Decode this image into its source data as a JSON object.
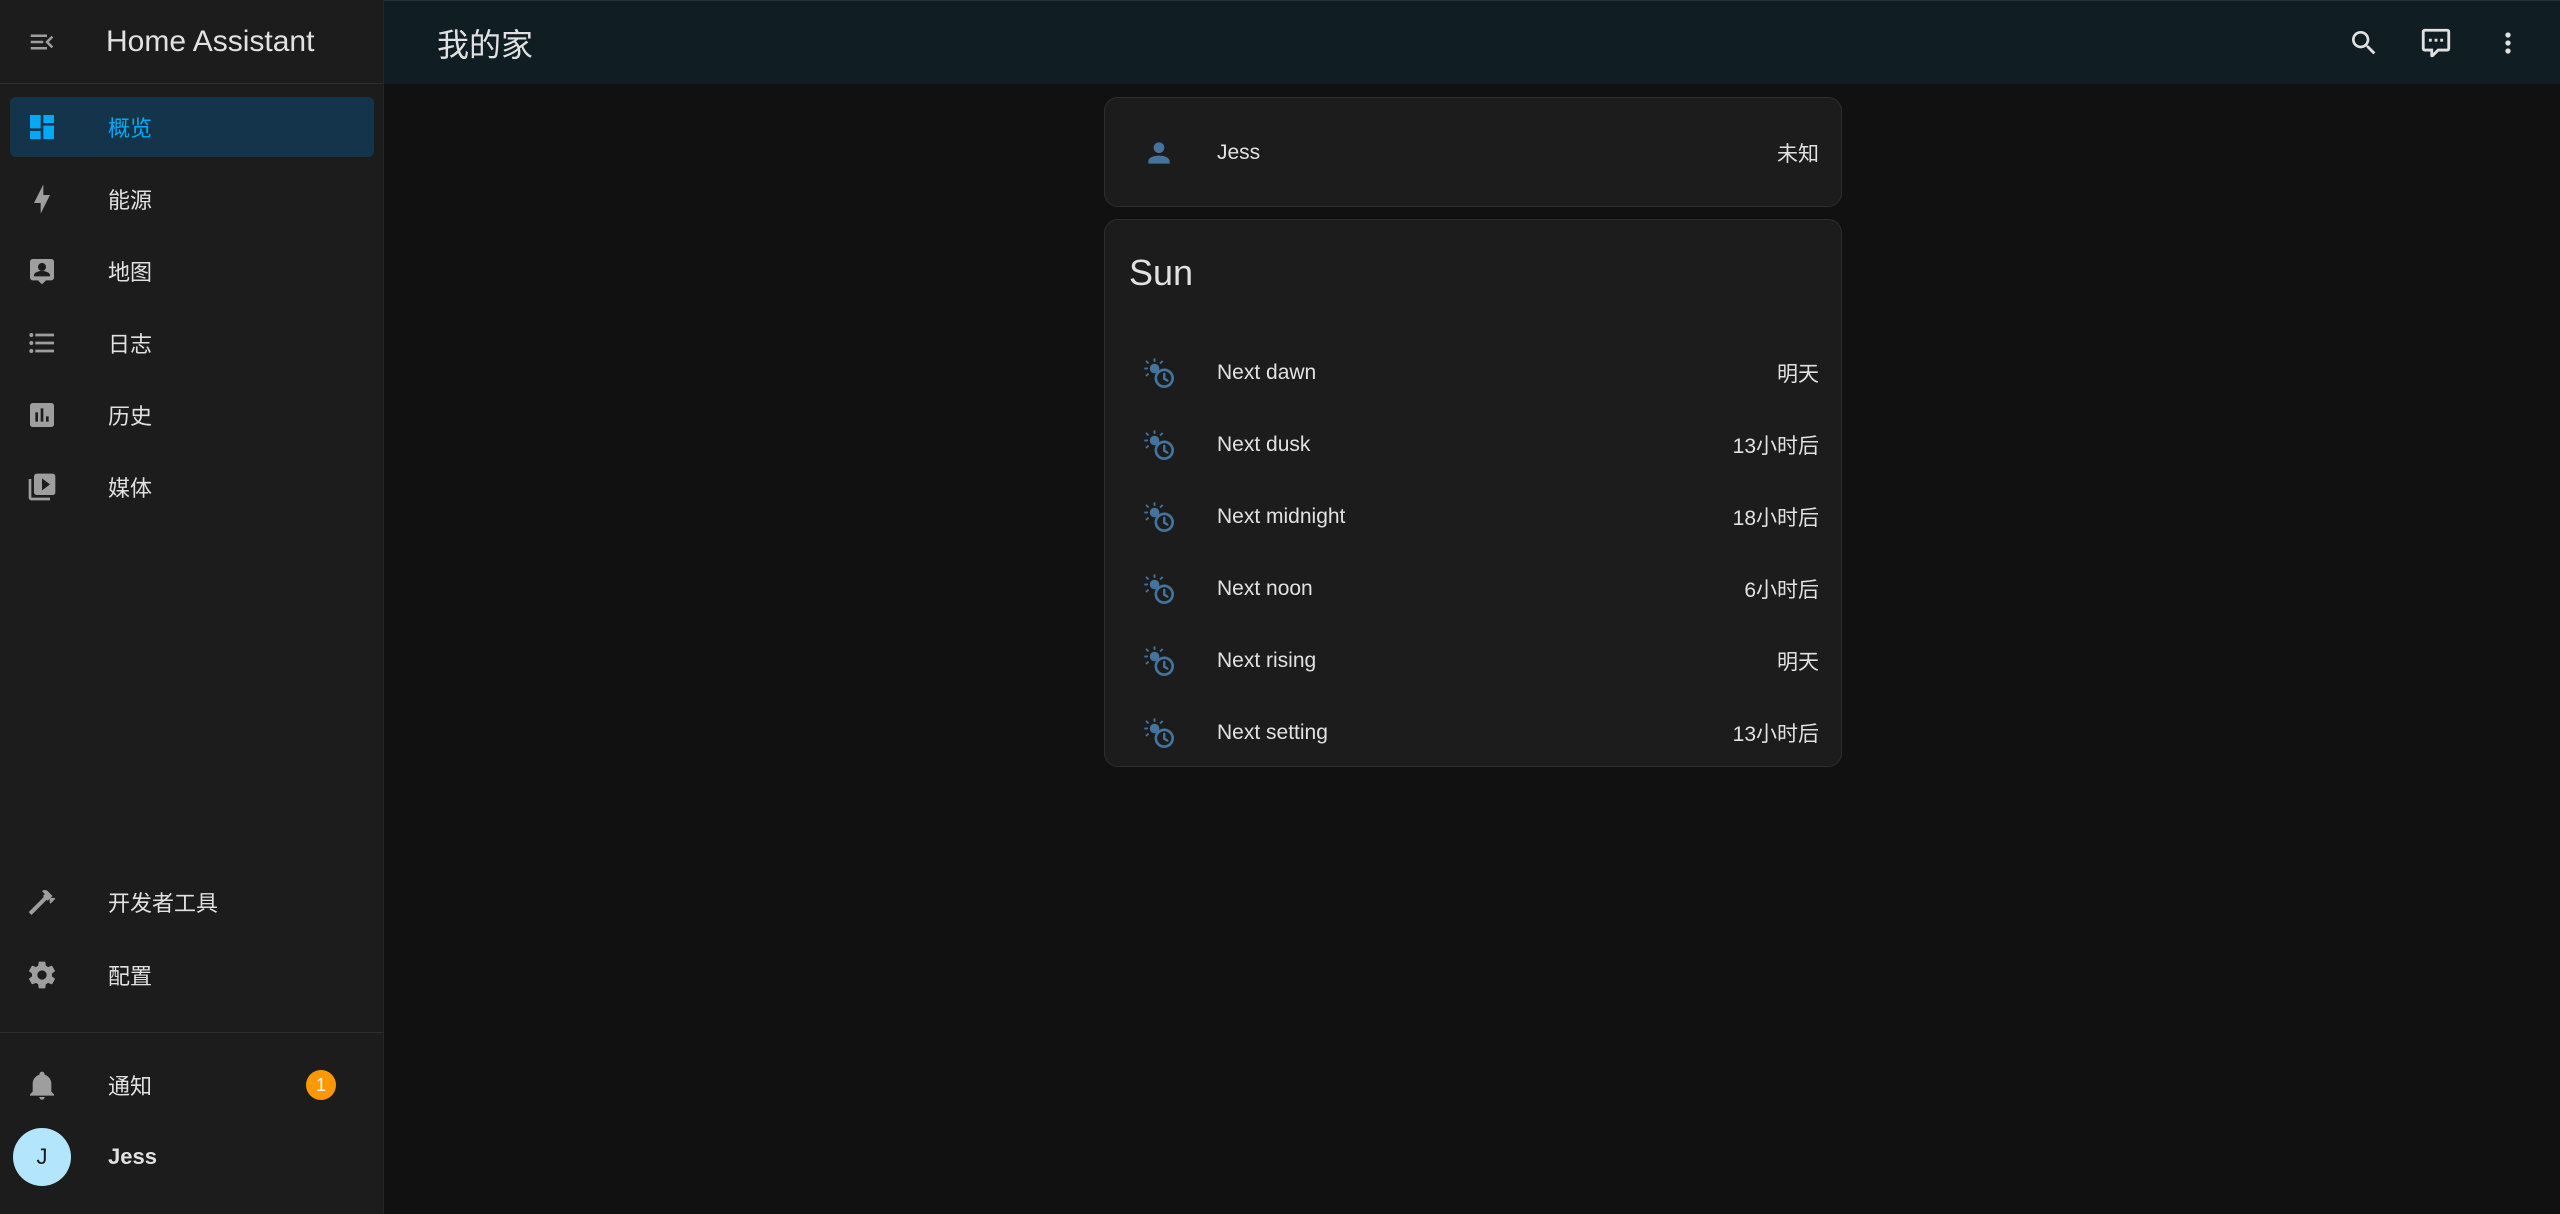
{
  "app": {
    "title": "Home Assistant"
  },
  "topbar": {
    "page_title": "我的家"
  },
  "sidebar": {
    "items": [
      {
        "label": "概览",
        "icon": "dashboard-icon"
      },
      {
        "label": "能源",
        "icon": "lightning-bolt-icon"
      },
      {
        "label": "地图",
        "icon": "map-account-icon"
      },
      {
        "label": "日志",
        "icon": "format-list-icon"
      },
      {
        "label": "历史",
        "icon": "chart-box-icon"
      },
      {
        "label": "媒体",
        "icon": "media-play-icon"
      }
    ],
    "bottom_items": [
      {
        "label": "开发者工具",
        "icon": "hammer-icon"
      },
      {
        "label": "配置",
        "icon": "gear-icon"
      }
    ],
    "notifications": {
      "label": "通知",
      "count": "1"
    },
    "user": {
      "initial": "J",
      "name": "Jess"
    }
  },
  "person_card": {
    "rows": [
      {
        "name": "Jess",
        "value": "未知"
      }
    ]
  },
  "sun_card": {
    "title": "Sun",
    "rows": [
      {
        "name": "Next dawn",
        "value": "明天"
      },
      {
        "name": "Next dusk",
        "value": "13小时后"
      },
      {
        "name": "Next midnight",
        "value": "18小时后"
      },
      {
        "name": "Next noon",
        "value": "6小时后"
      },
      {
        "name": "Next rising",
        "value": "明天"
      },
      {
        "name": "Next setting",
        "value": "13小时后"
      }
    ]
  },
  "colors": {
    "accent": "#03a9f4",
    "icon_blue": "#44739e",
    "badge": "#ff9800"
  }
}
